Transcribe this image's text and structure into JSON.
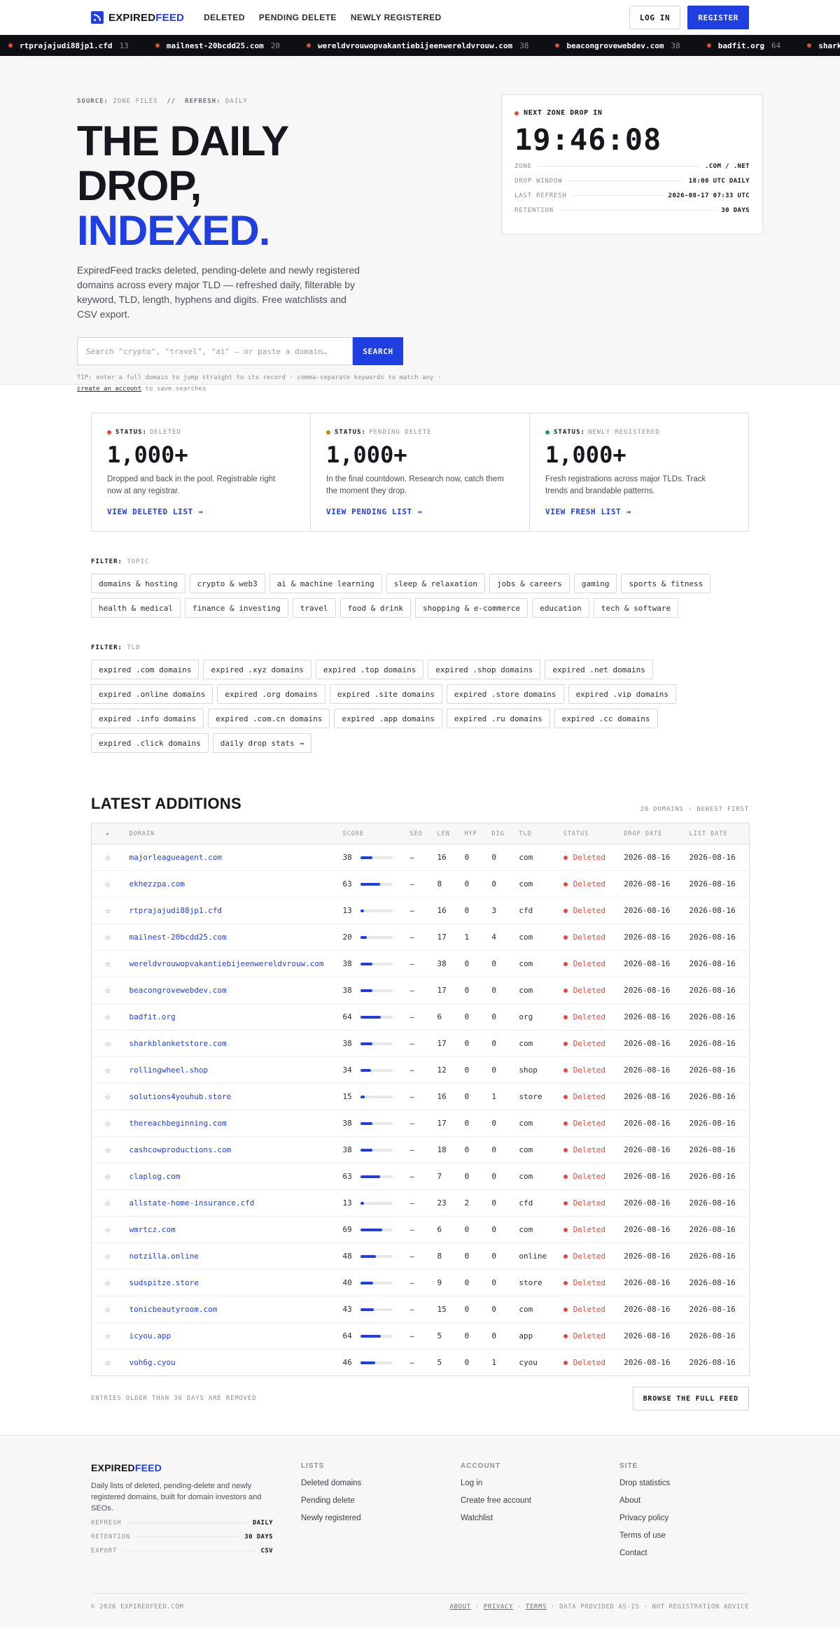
{
  "brand": {
    "part1": "EXPIRED",
    "part2": "FEED"
  },
  "nav": {
    "links": [
      "DELETED",
      "PENDING DELETE",
      "NEWLY REGISTERED"
    ],
    "login": "LOG IN",
    "register": "REGISTER"
  },
  "ticker": [
    {
      "domain": "rtprajajudi88jp1.cfd",
      "score": "13"
    },
    {
      "domain": "mailnest-20bcdd25.com",
      "score": "20"
    },
    {
      "domain": "wereldvrouwopvakantiebijeenwereldvrouw.com",
      "score": "38"
    },
    {
      "domain": "beacongrovewebdev.com",
      "score": "38"
    },
    {
      "domain": "badfit.org",
      "score": "64"
    },
    {
      "domain": "sharkblan",
      "score": ""
    }
  ],
  "hero": {
    "source_label": "SOURCE:",
    "source_value": "ZONE FILES",
    "sep": "//",
    "refresh_label": "REFRESH:",
    "refresh_value": "DAILY",
    "title_line1": "THE DAILY DROP,",
    "title_line2": "INDEXED.",
    "lead": "ExpiredFeed tracks deleted, pending-delete and newly registered domains across every major TLD — refreshed daily, filterable by keyword, TLD, length, hyphens and digits. Free watchlists and CSV export.",
    "search_placeholder": "Search \"crypto\", \"travel\", \"ai\" — or paste a domain…",
    "search_button": "SEARCH",
    "tip": "TIP: enter a full domain to jump straight to its record · comma-separate keywords to match any ·",
    "tip_link": "create an account",
    "tip_end": "to save searches"
  },
  "drop_card": {
    "label": "NEXT ZONE DROP IN",
    "countdown": "19:46:08",
    "rows": [
      {
        "k": "ZONE",
        "v": ".COM / .NET"
      },
      {
        "k": "DROP WINDOW",
        "v": "18:00 UTC DAILY"
      },
      {
        "k": "LAST REFRESH",
        "v": "2026-08-17 07:33 UTC"
      },
      {
        "k": "RETENTION",
        "v": "30 DAYS"
      }
    ]
  },
  "status_cards": [
    {
      "label": "STATUS:",
      "kind": "DELETED",
      "color": "#e04a3b",
      "count": "1,000+",
      "desc": "Dropped and back in the pool. Registrable right now at any registrar.",
      "link": "VIEW DELETED LIST →"
    },
    {
      "label": "STATUS:",
      "kind": "PENDING DELETE",
      "color": "#c98a16",
      "count": "1,000+",
      "desc": "In the final countdown. Research now, catch them the moment they drop.",
      "link": "VIEW PENDING LIST →"
    },
    {
      "label": "STATUS:",
      "kind": "NEWLY REGISTERED",
      "color": "#1f9a57",
      "count": "1,000+",
      "desc": "Fresh registrations across major TLDs. Track trends and brandable patterns.",
      "link": "VIEW FRESH LIST →"
    }
  ],
  "filter_topic": {
    "label": "FILTER:",
    "kind": "TOPIC",
    "chips": [
      "domains & hosting",
      "crypto & web3",
      "ai & machine learning",
      "sleep & relaxation",
      "jobs & careers",
      "gaming",
      "sports & fitness",
      "health & medical",
      "finance & investing",
      "travel",
      "food & drink",
      "shopping & e-commerce",
      "education",
      "tech & software"
    ]
  },
  "filter_tld": {
    "label": "FILTER:",
    "kind": "TLD",
    "chips": [
      "expired .com domains",
      "expired .xyz domains",
      "expired .top domains",
      "expired .shop domains",
      "expired .net domains",
      "expired .online domains",
      "expired .org domains",
      "expired .site domains",
      "expired .store domains",
      "expired .vip domains",
      "expired .info domains",
      "expired .com.cn domains",
      "expired .app domains",
      "expired .ru domains",
      "expired .cc domains",
      "expired .click domains",
      "daily drop stats →"
    ]
  },
  "latest": {
    "title": "LATEST ADDITIONS",
    "count": "20 DOMAINS · NEWEST FIRST",
    "columns": [
      "★",
      "DOMAIN",
      "SCORE",
      "SEO",
      "LEN",
      "HYP",
      "DIG",
      "TLD",
      "STATUS",
      "DROP DATE",
      "LIST DATE"
    ],
    "rows": [
      {
        "domain": "majorleagueagent.com",
        "score": 38,
        "seo": "—",
        "len": "16",
        "hyp": "0",
        "dig": "0",
        "tld": "com",
        "status": "Deleted",
        "drop": "2026-08-16",
        "list": "2026-08-16"
      },
      {
        "domain": "ekhezzpa.com",
        "score": 63,
        "seo": "—",
        "len": "8",
        "hyp": "0",
        "dig": "0",
        "tld": "com",
        "status": "Deleted",
        "drop": "2026-08-16",
        "list": "2026-08-16"
      },
      {
        "domain": "rtprajajudi88jp1.cfd",
        "score": 13,
        "seo": "—",
        "len": "16",
        "hyp": "0",
        "dig": "3",
        "tld": "cfd",
        "status": "Deleted",
        "drop": "2026-08-16",
        "list": "2026-08-16"
      },
      {
        "domain": "mailnest-20bcdd25.com",
        "score": 20,
        "seo": "—",
        "len": "17",
        "hyp": "1",
        "dig": "4",
        "tld": "com",
        "status": "Deleted",
        "drop": "2026-08-16",
        "list": "2026-08-16"
      },
      {
        "domain": "wereldvrouwopvakantiebijeenwereldvrouw.com",
        "score": 38,
        "seo": "—",
        "len": "38",
        "hyp": "0",
        "dig": "0",
        "tld": "com",
        "status": "Deleted",
        "drop": "2026-08-16",
        "list": "2026-08-16"
      },
      {
        "domain": "beacongrovewebdev.com",
        "score": 38,
        "seo": "—",
        "len": "17",
        "hyp": "0",
        "dig": "0",
        "tld": "com",
        "status": "Deleted",
        "drop": "2026-08-16",
        "list": "2026-08-16"
      },
      {
        "domain": "badfit.org",
        "score": 64,
        "seo": "—",
        "len": "6",
        "hyp": "0",
        "dig": "0",
        "tld": "org",
        "status": "Deleted",
        "drop": "2026-08-16",
        "list": "2026-08-16"
      },
      {
        "domain": "sharkblanketstore.com",
        "score": 38,
        "seo": "—",
        "len": "17",
        "hyp": "0",
        "dig": "0",
        "tld": "com",
        "status": "Deleted",
        "drop": "2026-08-16",
        "list": "2026-08-16"
      },
      {
        "domain": "rollingwheel.shop",
        "score": 34,
        "seo": "—",
        "len": "12",
        "hyp": "0",
        "dig": "0",
        "tld": "shop",
        "status": "Deleted",
        "drop": "2026-08-16",
        "list": "2026-08-16"
      },
      {
        "domain": "solutions4youhub.store",
        "score": 15,
        "seo": "—",
        "len": "16",
        "hyp": "0",
        "dig": "1",
        "tld": "store",
        "status": "Deleted",
        "drop": "2026-08-16",
        "list": "2026-08-16"
      },
      {
        "domain": "thereachbeginning.com",
        "score": 38,
        "seo": "—",
        "len": "17",
        "hyp": "0",
        "dig": "0",
        "tld": "com",
        "status": "Deleted",
        "drop": "2026-08-16",
        "list": "2026-08-16"
      },
      {
        "domain": "cashcowproductions.com",
        "score": 38,
        "seo": "—",
        "len": "18",
        "hyp": "0",
        "dig": "0",
        "tld": "com",
        "status": "Deleted",
        "drop": "2026-08-16",
        "list": "2026-08-16"
      },
      {
        "domain": "claplog.com",
        "score": 63,
        "seo": "—",
        "len": "7",
        "hyp": "0",
        "dig": "0",
        "tld": "com",
        "status": "Deleted",
        "drop": "2026-08-16",
        "list": "2026-08-16"
      },
      {
        "domain": "allstate-home-insurance.cfd",
        "score": 13,
        "seo": "—",
        "len": "23",
        "hyp": "2",
        "dig": "0",
        "tld": "cfd",
        "status": "Deleted",
        "drop": "2026-08-16",
        "list": "2026-08-16"
      },
      {
        "domain": "wmrtcz.com",
        "score": 69,
        "seo": "—",
        "len": "6",
        "hyp": "0",
        "dig": "0",
        "tld": "com",
        "status": "Deleted",
        "drop": "2026-08-16",
        "list": "2026-08-16"
      },
      {
        "domain": "notzilla.online",
        "score": 48,
        "seo": "—",
        "len": "8",
        "hyp": "0",
        "dig": "0",
        "tld": "online",
        "status": "Deleted",
        "drop": "2026-08-16",
        "list": "2026-08-16"
      },
      {
        "domain": "sudspitze.store",
        "score": 40,
        "seo": "—",
        "len": "9",
        "hyp": "0",
        "dig": "0",
        "tld": "store",
        "status": "Deleted",
        "drop": "2026-08-16",
        "list": "2026-08-16"
      },
      {
        "domain": "tonicbeautyroom.com",
        "score": 43,
        "seo": "—",
        "len": "15",
        "hyp": "0",
        "dig": "0",
        "tld": "com",
        "status": "Deleted",
        "drop": "2026-08-16",
        "list": "2026-08-16"
      },
      {
        "domain": "icyou.app",
        "score": 64,
        "seo": "—",
        "len": "5",
        "hyp": "0",
        "dig": "0",
        "tld": "app",
        "status": "Deleted",
        "drop": "2026-08-16",
        "list": "2026-08-16"
      },
      {
        "domain": "voh6g.cyou",
        "score": 46,
        "seo": "—",
        "len": "5",
        "hyp": "0",
        "dig": "1",
        "tld": "cyou",
        "status": "Deleted",
        "drop": "2026-08-16",
        "list": "2026-08-16"
      }
    ],
    "foot_note": "ENTRIES OLDER THAN 30 DAYS ARE REMOVED",
    "browse": "BROWSE THE FULL FEED"
  },
  "footer": {
    "desc": "Daily lists of deleted, pending-delete and newly registered domains, built for domain investors and SEOs.",
    "rows": [
      {
        "k": "REFRESH",
        "v": "DAILY"
      },
      {
        "k": "RETENTION",
        "v": "30 DAYS"
      },
      {
        "k": "EXPORT",
        "v": "CSV"
      }
    ],
    "cols": [
      {
        "title": "LISTS",
        "links": [
          "Deleted domains",
          "Pending delete",
          "Newly registered"
        ]
      },
      {
        "title": "ACCOUNT",
        "links": [
          "Log in",
          "Create free account",
          "Watchlist"
        ]
      },
      {
        "title": "SITE",
        "links": [
          "Drop statistics",
          "About",
          "Privacy policy",
          "Terms of use",
          "Contact"
        ]
      }
    ],
    "copyright": "© 2026 EXPIREDFEED.COM",
    "bottom_links": [
      "ABOUT",
      "PRIVACY",
      "TERMS"
    ],
    "bottom_note": "DATA PROVIDED AS-IS · NOT REGISTRATION ADVICE"
  }
}
